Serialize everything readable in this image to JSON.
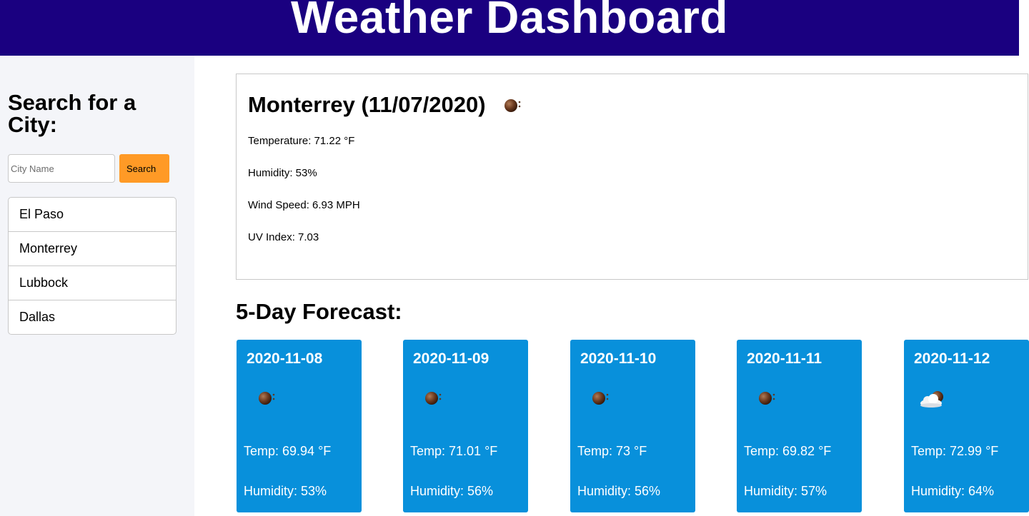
{
  "header": {
    "title": "Weather Dashboard"
  },
  "sidebar": {
    "heading": "Search for a City:",
    "search": {
      "placeholder": "City Name",
      "value": "",
      "button_label": "Search"
    },
    "history": [
      {
        "label": "El Paso"
      },
      {
        "label": "Monterrey"
      },
      {
        "label": "Lubbock"
      },
      {
        "label": "Dallas"
      }
    ]
  },
  "current": {
    "title": "Monterrey (11/07/2020)",
    "icon": "clear-night-icon",
    "temperature": "Temperature: 71.22 °F",
    "humidity": "Humidity: 53%",
    "wind": "Wind Speed: 6.93 MPH",
    "uv": "UV Index: 7.03"
  },
  "forecast": {
    "title": "5-Day Forecast:",
    "days": [
      {
        "date": "2020-11-08",
        "icon": "clear-night-icon",
        "temp": "Temp: 69.94 °F",
        "humidity": "Humidity: 53%"
      },
      {
        "date": "2020-11-09",
        "icon": "clear-night-icon",
        "temp": "Temp: 71.01 °F",
        "humidity": "Humidity: 56%"
      },
      {
        "date": "2020-11-10",
        "icon": "clear-night-icon",
        "temp": "Temp: 73 °F",
        "humidity": "Humidity: 56%"
      },
      {
        "date": "2020-11-11",
        "icon": "clear-night-icon",
        "temp": "Temp: 69.82 °F",
        "humidity": "Humidity: 57%"
      },
      {
        "date": "2020-11-12",
        "icon": "cloudy-night-icon",
        "temp": "Temp: 72.99 °F",
        "humidity": "Humidity: 64%"
      }
    ]
  },
  "colors": {
    "header_bg": "#1a0080",
    "sidebar_bg": "#f4f5f9",
    "search_button": "#ff9a26",
    "card_bg": "#0890db"
  }
}
